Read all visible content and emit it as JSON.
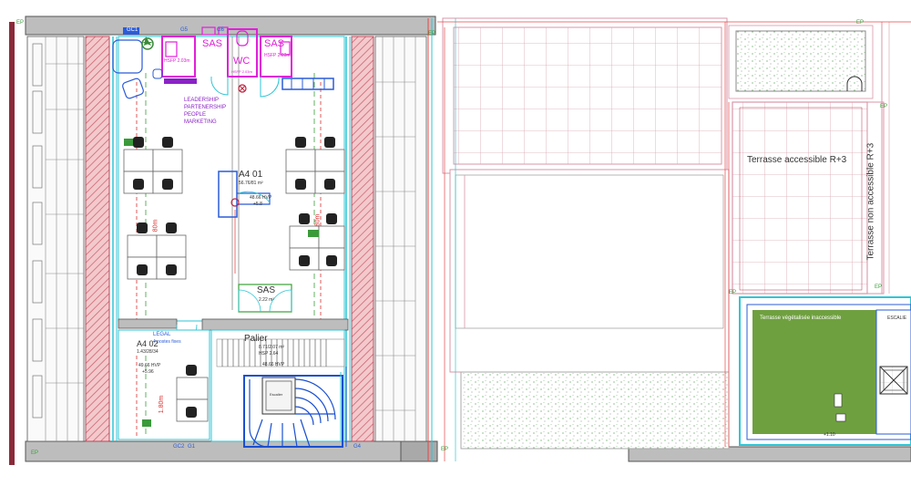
{
  "plan": {
    "rooms": {
      "sas_left": "SAS",
      "sas_left_sub": "HSFP 2.03m",
      "wc": "WC",
      "wc_sub": "HSFP 2.03m",
      "sas_right": "SAS",
      "sas_right_sub": "HSFP 2.03m",
      "a401": "A4 01",
      "a401_sub": "56.76/81 m²",
      "a401_hsp": "48.66 HVP",
      "a401_num": "+5.8",
      "sas_mid": "SAS",
      "sas_mid_sub": "2.22 m²",
      "a402": "A4 02",
      "a402_sub": "1.43/28/34",
      "a402_hsp": "49.66 HVP",
      "a402_num": "+5.96",
      "palier": "Palier",
      "palier_sub": "8.71/2.07 m²",
      "palier_hsp": "HSP 2.64",
      "palier_extra": "48.66 HVP",
      "legal": "LEGAL",
      "legal_sub": "4 postes fixes",
      "stair_label": "Escalier"
    },
    "notes": {
      "line1": "LEADERSHIP",
      "line2": "PARTENERSHIP",
      "line3": "PEOPLE",
      "line4": "MARKETING"
    },
    "tags": {
      "gc1": "GC1",
      "g5": "G5",
      "g6": "G6",
      "gc2": "GC2",
      "g1": "G1",
      "g4": "G4",
      "ep_top_left": "EP",
      "ep_top_mid": "EP",
      "ep_top_right": "EP",
      "ep_bottom_left": "EP",
      "ep_bottom_mid": "EP",
      "ep_right": "EP",
      "ep_right2": "EP",
      "ep_green": "EP",
      "dim1": "80m",
      "dim2": "80m",
      "dim3": "1.80m"
    },
    "terrace": {
      "accessible": "Terrasse accessible R+3",
      "non_accessible": "Terrasse non accessible R+3",
      "vegetal": "Terrasse végétalisée inaccessible",
      "escalier": "ESCALIE",
      "code": "+1.10"
    },
    "colors": {
      "wall_hatch": "#d9868e",
      "magenta": "#e020d8",
      "cyan": "#2ec6d6",
      "blue": "#1a4fd0",
      "green_roof": "#6fa040",
      "red_line": "#e84848",
      "dark": "#333333",
      "grid": "#d896a8"
    }
  }
}
